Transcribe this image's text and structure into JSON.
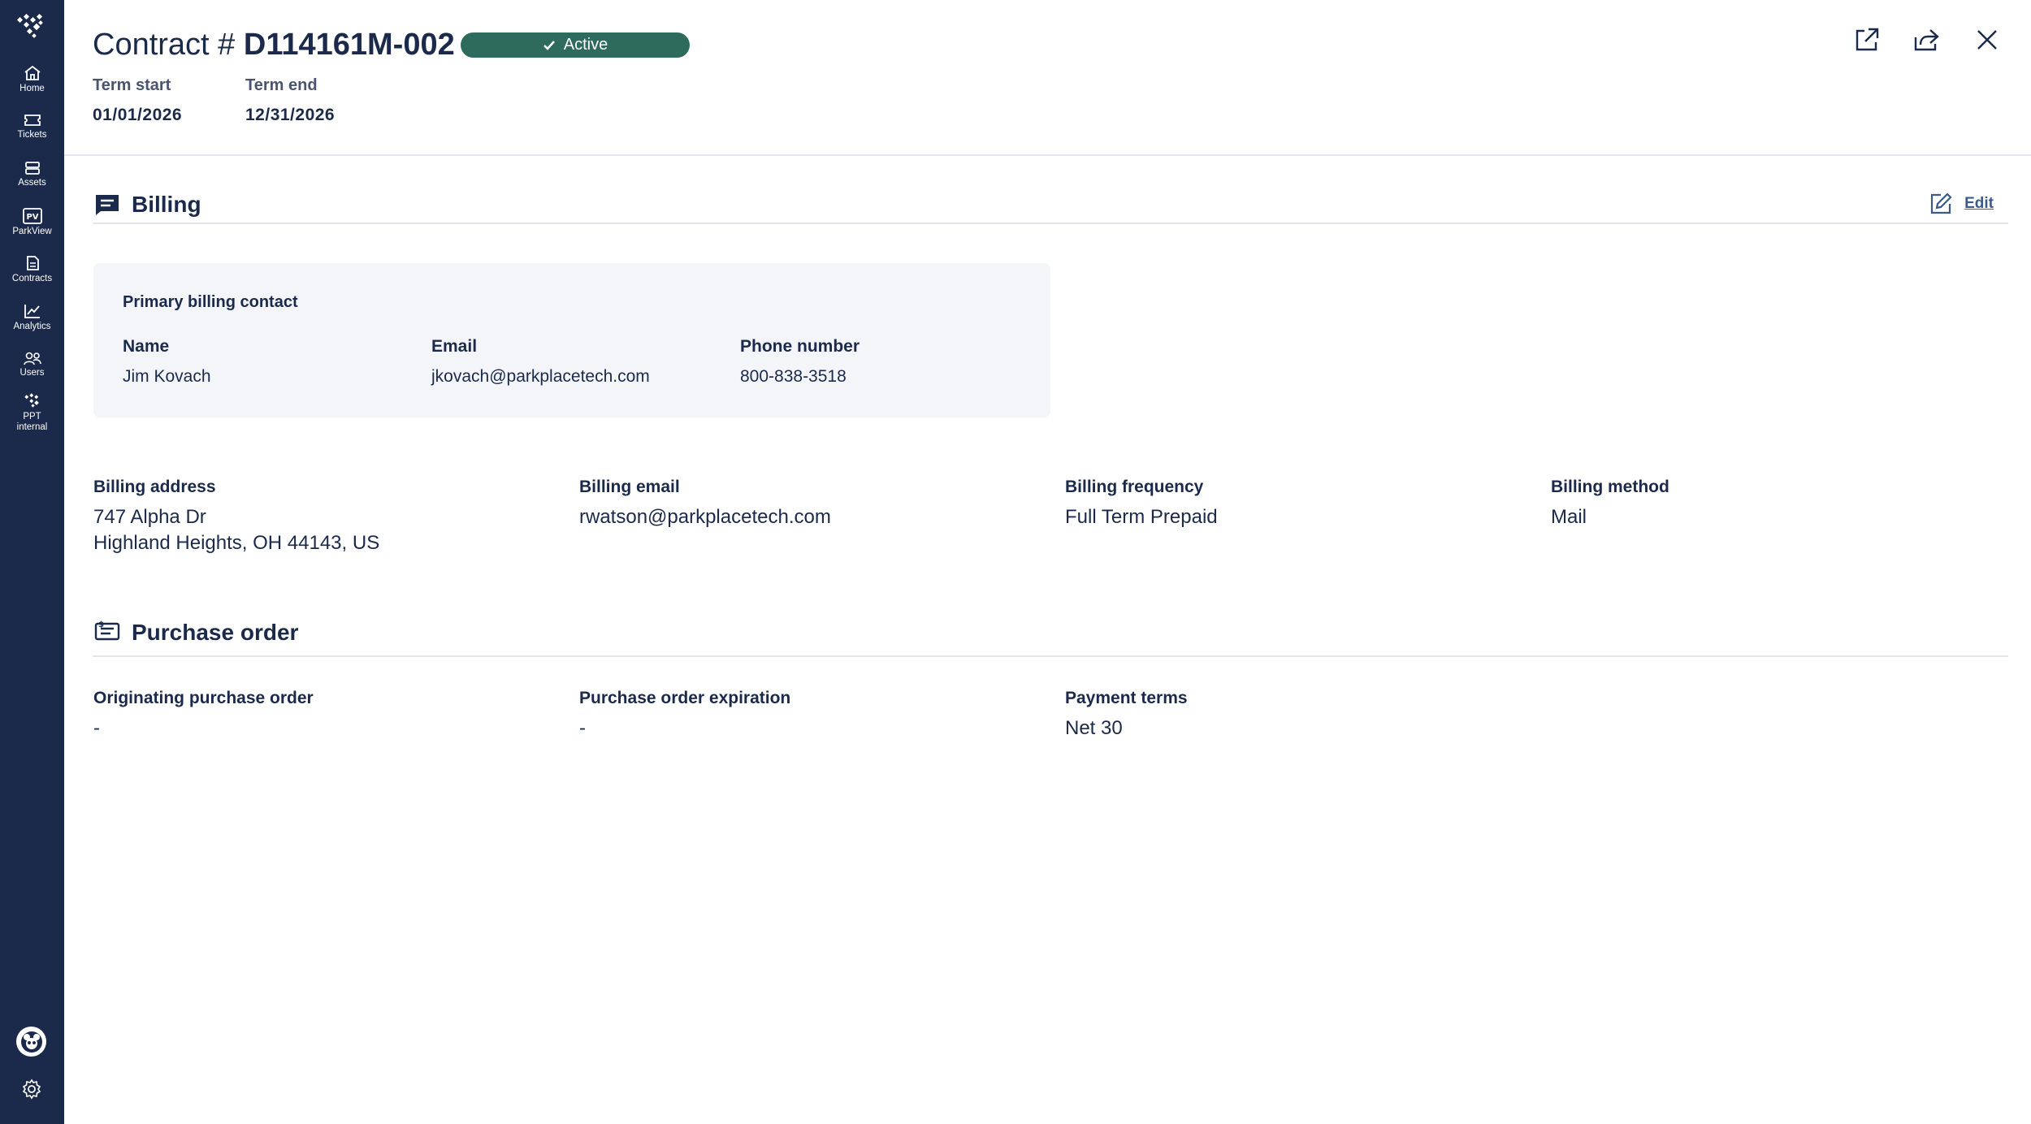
{
  "sidebar": {
    "items": [
      {
        "label": "Home",
        "icon": "home-icon"
      },
      {
        "label": "Tickets",
        "icon": "ticket-icon"
      },
      {
        "label": "Assets",
        "icon": "server-icon"
      },
      {
        "label": "ParkView",
        "icon": "pv-icon"
      },
      {
        "label": "Contracts",
        "icon": "document-icon"
      },
      {
        "label": "Analytics",
        "icon": "chart-icon"
      },
      {
        "label": "Users",
        "icon": "users-icon"
      },
      {
        "label": "PPT internal",
        "icon": "ppt-logo-icon"
      }
    ]
  },
  "header": {
    "title_prefix": "Contract # ",
    "contract_number": "D114161M-002",
    "status": "Active",
    "term_start_label": "Term start",
    "term_start_value": "01/01/2026",
    "term_end_label": "Term end",
    "term_end_value": "12/31/2026"
  },
  "billing": {
    "title": "Billing",
    "edit_label": "Edit",
    "contact_card": {
      "title": "Primary billing contact",
      "name_label": "Name",
      "name_value": "Jim Kovach",
      "email_label": "Email",
      "email_value": "jkovach@parkplacetech.com",
      "phone_label": "Phone number",
      "phone_value": "800-838-3518"
    },
    "address_label": "Billing address",
    "address_line1": "747 Alpha Dr",
    "address_line2": "Highland Heights, OH 44143, US",
    "email_label": "Billing email",
    "email_value": "rwatson@parkplacetech.com",
    "frequency_label": "Billing frequency",
    "frequency_value": "Full Term Prepaid",
    "method_label": "Billing method",
    "method_value": "Mail"
  },
  "purchase_order": {
    "title": "Purchase order",
    "originating_label": "Originating purchase order",
    "originating_value": "-",
    "expiration_label": "Purchase order expiration",
    "expiration_value": "-",
    "terms_label": "Payment terms",
    "terms_value": "Net 30"
  },
  "colors": {
    "sidebar_bg": "#1b2a4a",
    "status_badge": "#2e6b5c",
    "card_bg": "#f3f5f9",
    "link": "#3a5a8c"
  }
}
